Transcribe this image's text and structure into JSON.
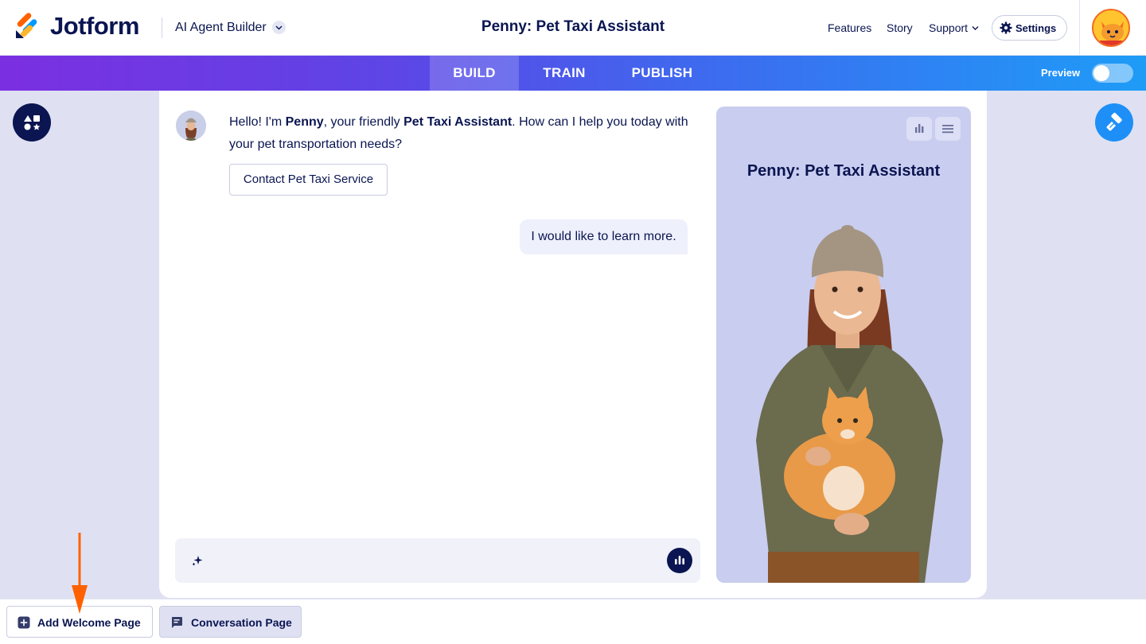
{
  "header": {
    "brand": "Jotform",
    "product": "AI Agent Builder",
    "title": "Penny: Pet Taxi Assistant",
    "nav": [
      "Features",
      "Story",
      "Support"
    ],
    "settings_label": "Settings"
  },
  "tabs": [
    {
      "label": "BUILD",
      "active": true
    },
    {
      "label": "TRAIN",
      "active": false
    },
    {
      "label": "PUBLISH",
      "active": false
    }
  ],
  "preview": {
    "label": "Preview",
    "enabled": false
  },
  "chat": {
    "bot_message": {
      "prefix": "Hello! I'm ",
      "name": "Penny",
      "middle": ", your friendly ",
      "role": "Pet Taxi Assistant",
      "suffix": ". How can I help you today with your pet transportation needs?"
    },
    "quick_reply": "Contact Pet Taxi Service",
    "user_message": "I would like to learn more."
  },
  "agent_panel": {
    "title": "Penny: Pet Taxi Assistant"
  },
  "bottom": {
    "add_welcome": "Add Welcome Page",
    "conversation": "Conversation Page"
  },
  "colors": {
    "navy": "#0a1551",
    "accent_blue": "#1e8ff7",
    "arrow": "#ff6100",
    "panel_bg": "#c9cdef"
  }
}
